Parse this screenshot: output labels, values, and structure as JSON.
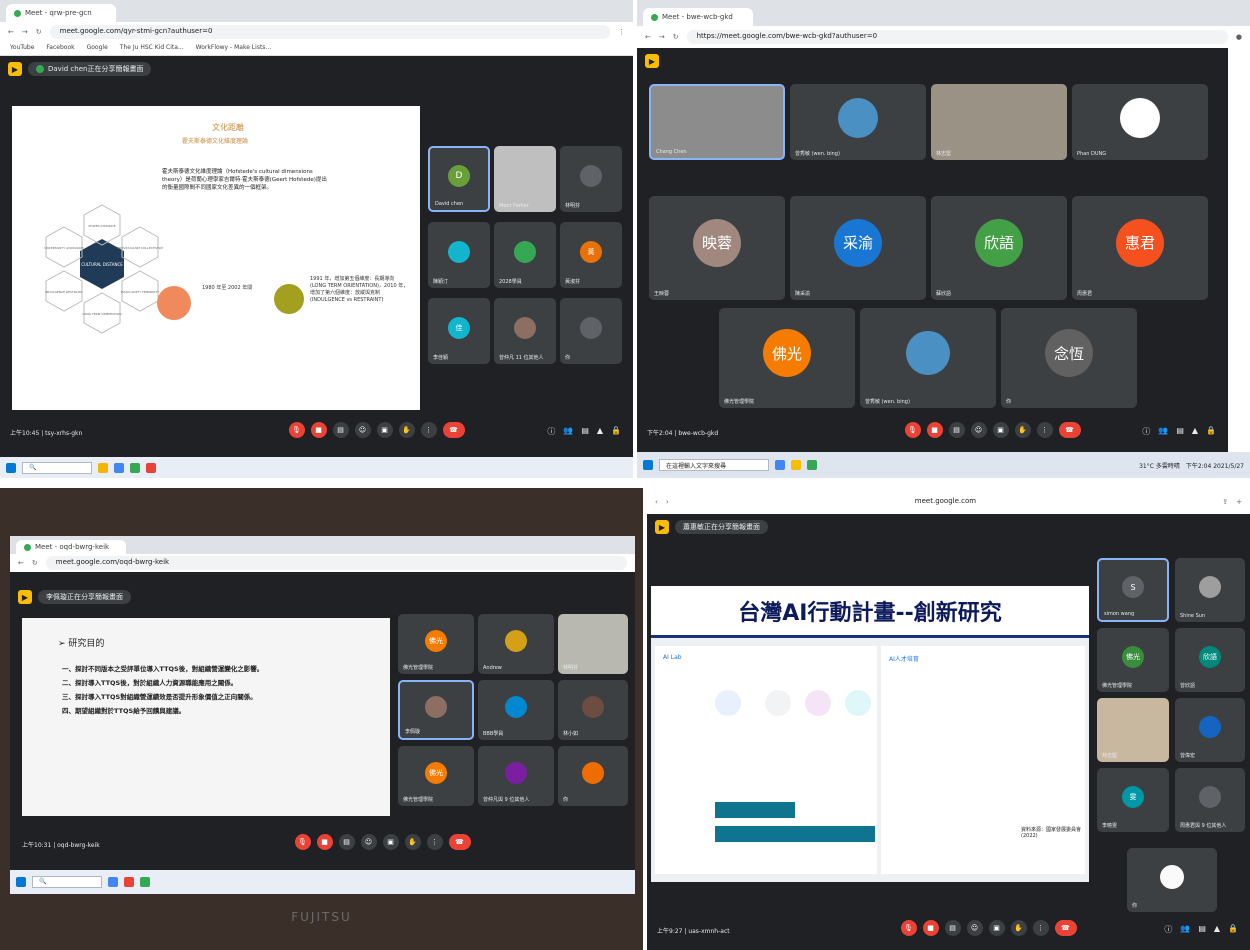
{
  "q1": {
    "tab_title": "Meet - qrw-pre-gcn",
    "url": "meet.google.com/qyr-stmi-gcn?authuser=0",
    "bookmarks": [
      "YouTube",
      "Facebook",
      "Google",
      "The Ju HSC Kid Cita...",
      "WorkFlowy - Make Lists..."
    ],
    "presenter": "David chen正在分享簡報畫面",
    "slide": {
      "title": "文化距離",
      "subtitle": "霍夫斯泰德文化維度理論",
      "body_line1": "霍夫斯泰德文化維度理論（Hofstede's cultural dimensions",
      "body_line2": "theory）是荷蘭心理學家吉爾特·霍夫斯泰德(Geert Hofstede)提出",
      "body_line3": "的衡量國際間不同國家文化差異的一個框架。",
      "center_label": "CULTURAL DISTANCE",
      "hex_labels": [
        "POWER DISTANCE",
        "UNCERTAINTY AVOIDANCE",
        "INDIVIDUALISM COLLECTIVISM",
        "MASCULINITY FEMININITY",
        "LONG TERM ORIENTATION",
        "INDULGENCE RESTRAINT"
      ],
      "left_note": "1980 年至 2002 年間",
      "right_note": "1991 年，增加第五個維度：長期導向 (LONG TERM ORIENTATION)，2010 年，增加了第六個維度：放縱與克制 (INDULGENCE vs RESTRAINT)"
    },
    "participants": [
      {
        "name": "David chen",
        "initial": "D",
        "color": "#689f38"
      },
      {
        "name": "Meet Parker",
        "initial": "",
        "color": "#5f6368"
      },
      {
        "name": "林明芬",
        "initial": "",
        "color": "#5f6368"
      },
      {
        "name": "陳穎汀",
        "initial": "",
        "color": "#1a73e8"
      },
      {
        "name": "2028學員",
        "initial": "",
        "color": "#34a853"
      },
      {
        "name": "黃淑芬",
        "initial": "黃",
        "color": "#e8710a"
      },
      {
        "name": "李佳穎",
        "initial": "佳",
        "color": "#12b5cb"
      },
      {
        "name": "曾仲凡 11 位其他人",
        "initial": "",
        "color": "#5f6368"
      },
      {
        "name": "你",
        "initial": "",
        "color": "#5f6368"
      }
    ],
    "time": "上午10:45",
    "meeting_code": "tsy-xrhs-gkn"
  },
  "q2": {
    "tab_title": "Meet - bwe-wcb-gkd",
    "url": "https://meet.google.com/bwe-wcb-gkd?authuser=0",
    "participants": [
      {
        "name": "Chang Chen",
        "initial": "",
        "color": "#4a4a4a"
      },
      {
        "name": "曾秀敏 (wen. bing)",
        "initial": "",
        "color": "#4a90c2"
      },
      {
        "name": "林志堅",
        "initial": "",
        "color": "#6b6b6b"
      },
      {
        "name": "Phan DUNG",
        "initial": "",
        "color": "#ffffff"
      },
      {
        "name": "王映蓉",
        "initial": "映蓉",
        "color": "#a1887f"
      },
      {
        "name": "陳采渝",
        "initial": "采渝",
        "color": "#1976d2"
      },
      {
        "name": "蘇欣語",
        "initial": "欣語",
        "color": "#43a047"
      },
      {
        "name": "周惠君",
        "initial": "惠君",
        "color": "#f4511e"
      },
      {
        "name": "佛光管理學院",
        "initial": "佛光",
        "color": "#f57c00"
      },
      {
        "name": "曾秀敏 (wen. bing)",
        "initial": "",
        "color": "#4a90c2"
      },
      {
        "name": "念恆",
        "initial": "念恆",
        "color": "#616161"
      }
    ],
    "time": "下午2:04",
    "meeting_code": "bwe-wcb-gkd",
    "search_placeholder": "在這裡輸入文字來搜尋",
    "weather": "31°C 多雲時晴",
    "clock": "下午2:04 2021/5/27"
  },
  "q3": {
    "tab_title": "Meet - oqd-bwrg-keik",
    "url": "meet.google.com/oqd-bwrg-keik",
    "presenter": "李佩璇正在分享簡報畫面",
    "slide": {
      "heading": "研究目的",
      "items": [
        "一、探討不同版本之受評單位導入TTQS後，對組織營運變化之影響。",
        "二、探討導入TTQS後，對於組織人力資源職能應用之關係。",
        "三、探討導入TTQS對組織營運績效是否提升形象價值之正向關係。",
        "四、期望組織對於TTQS給予回饋與建議。"
      ]
    },
    "participants": [
      {
        "name": "佛光管理學院",
        "initial": "佛光",
        "color": "#f57c00"
      },
      {
        "name": "Andrew",
        "initial": "",
        "color": "#d4a017"
      },
      {
        "name": "林明芬",
        "initial": "",
        "color": "#8d6e63"
      },
      {
        "name": "李佩璇",
        "initial": "",
        "color": "#5f6368"
      },
      {
        "name": "BBB學員",
        "initial": "",
        "color": "#0288d1"
      },
      {
        "name": "林小如",
        "initial": "",
        "color": "#6d4c41"
      },
      {
        "name": "佛光管理學院",
        "initial": "佛光",
        "color": "#f57c00"
      },
      {
        "name": "曾仲凡與 9 位其他人",
        "initial": "",
        "color": "#7b1fa2"
      },
      {
        "name": "你",
        "initial": "",
        "color": "#ef6c00"
      }
    ],
    "time": "上午10:31",
    "meeting_code": "oqd-bwrg-keik",
    "laptop_brand": "FUJITSU"
  },
  "q4": {
    "url": "meet.google.com",
    "presenter": "蕭惠敏正在分享簡報畫面",
    "slide": {
      "title": "台灣AI行動計畫--創新研究",
      "left_section": "AI Lab",
      "right_section": "AI人才培育",
      "source": "資料來源：國家發展委員會(2022)"
    },
    "participants": [
      {
        "name": "simon wang",
        "initial": "S",
        "color": "#5f6368"
      },
      {
        "name": "Shine Sun",
        "initial": "",
        "color": "#9e9e9e"
      },
      {
        "name": "佛光管理學院",
        "initial": "佛光",
        "color": "#388e3c"
      },
      {
        "name": "曾欣語",
        "initial": "欣語",
        "color": "#00897b"
      },
      {
        "name": "林志堅",
        "initial": "",
        "color": "#8d6e63"
      },
      {
        "name": "曾偉宏",
        "initial": "",
        "color": "#1565c0"
      },
      {
        "name": "李曉雯",
        "initial": "雯",
        "color": "#0097a7"
      },
      {
        "name": "周惠君與 9 位其他人",
        "initial": "",
        "color": "#5f6368"
      },
      {
        "name": "你",
        "initial": "",
        "color": "#fafafa"
      }
    ],
    "time": "上午9:27",
    "meeting_code": "uas-xmnh-act"
  }
}
